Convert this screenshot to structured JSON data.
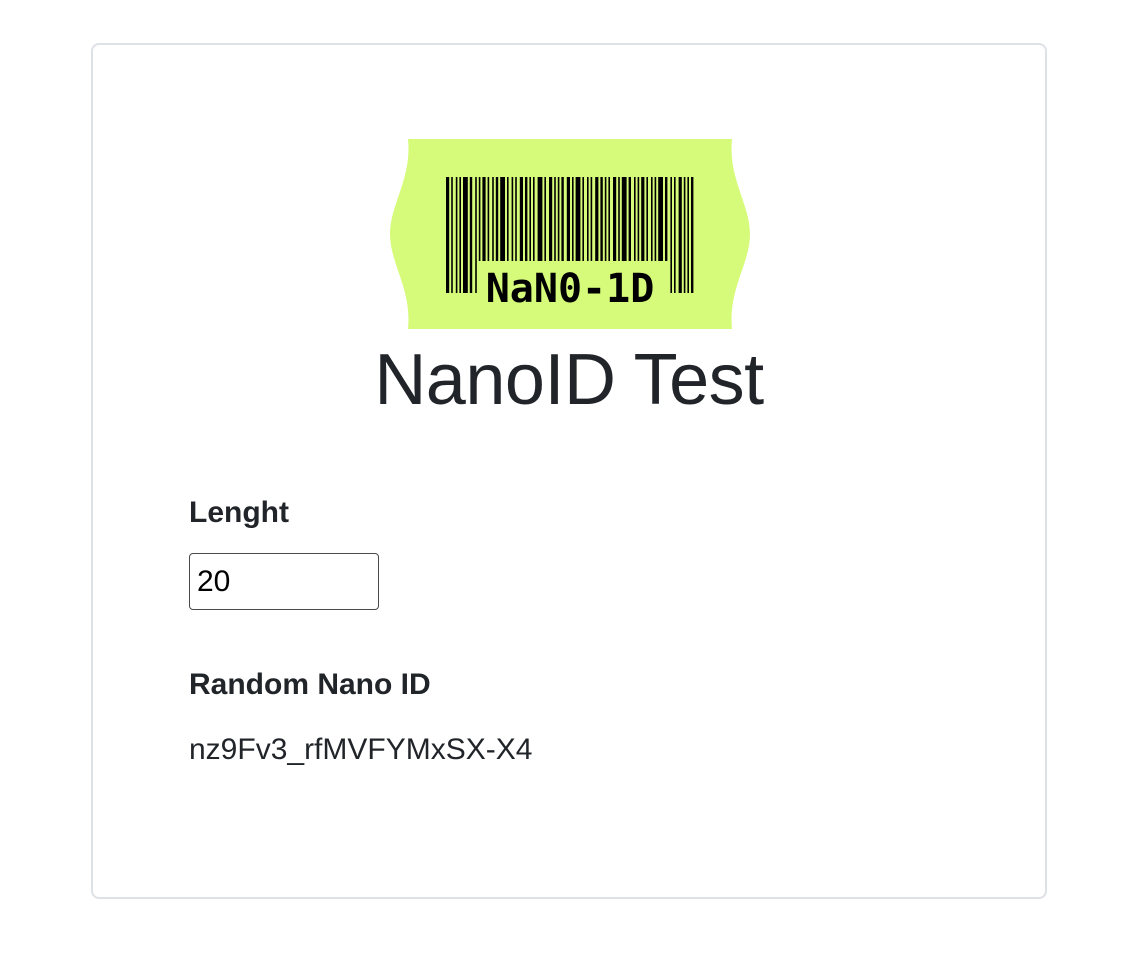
{
  "logo": {
    "text": "NaN0-1D",
    "icon": "barcode-icon",
    "background_color": "#d6fa79",
    "ink_color": "#000000"
  },
  "header": {
    "title": "NanoID Test"
  },
  "form": {
    "length_label": "Lenght",
    "length_value": "20",
    "result_label": "Random Nano ID",
    "result_value": "nz9Fv3_rfMVFYMxSX-X4"
  },
  "colors": {
    "text": "#212529",
    "card_border": "#dee2e6"
  }
}
